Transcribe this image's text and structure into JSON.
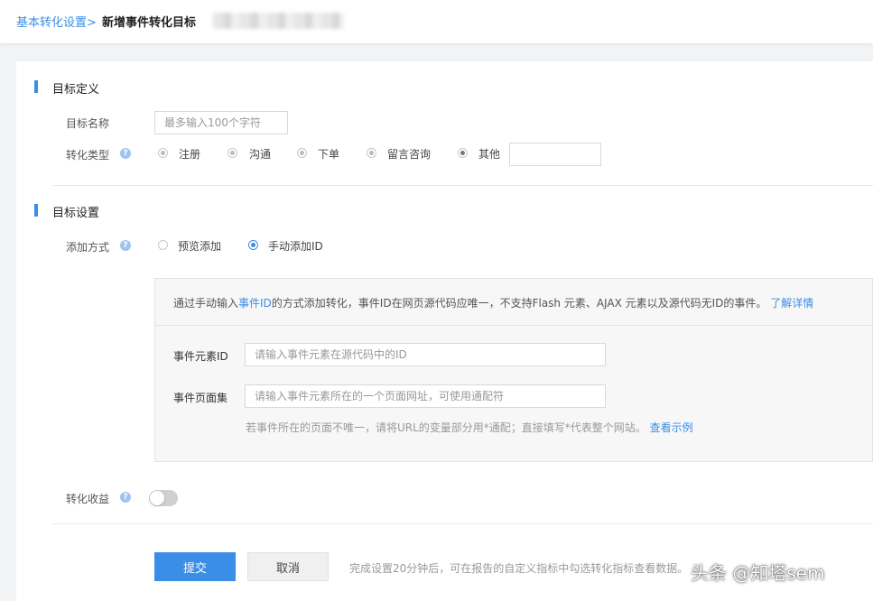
{
  "breadcrumb": {
    "link": "基本转化设置>",
    "current": "新增事件转化目标"
  },
  "goal_definition": {
    "title": "目标定义",
    "name_label": "目标名称",
    "name_placeholder": "最多输入100个字符",
    "type_label": "转化类型",
    "types": [
      {
        "label": "注册",
        "selected": false
      },
      {
        "label": "沟通",
        "selected": false
      },
      {
        "label": "下单",
        "selected": false
      },
      {
        "label": "留言咨询",
        "selected": false
      },
      {
        "label": "其他",
        "selected": true
      }
    ],
    "other_value": ""
  },
  "goal_settings": {
    "title": "目标设置",
    "method_label": "添加方式",
    "methods": [
      {
        "label": "预览添加",
        "selected": false
      },
      {
        "label": "手动添加ID",
        "selected": true
      }
    ],
    "info": {
      "prefix": "通过手动输入",
      "highlight": "事件ID",
      "suffix": "的方式添加转化，事件ID在网页源代码应唯一，不支持Flash 元素、AJAX 元素以及源代码无ID的事件。",
      "link": "了解详情"
    },
    "event_id_label": "事件元素ID",
    "event_id_placeholder": "请输入事件元素在源代码中的ID",
    "event_page_label": "事件页面集",
    "event_page_placeholder": "请输入事件元素所在的一个页面网址，可使用通配符",
    "page_hint": "若事件所在的页面不唯一，请将URL的变量部分用*通配；直接填写*代表整个网站。",
    "example_link": "查看示例",
    "revenue_label": "转化收益",
    "revenue_enabled": false
  },
  "actions": {
    "submit": "提交",
    "cancel": "取消",
    "hint": "完成设置20分钟后，可在报告的自定义指标中勾选转化指标查看数据。"
  },
  "watermark": "头条 @知塔sem",
  "colors": {
    "accent": "#3a8ee6",
    "help": "#9ec5f0"
  },
  "icons": {
    "help": "question-circle-icon"
  }
}
